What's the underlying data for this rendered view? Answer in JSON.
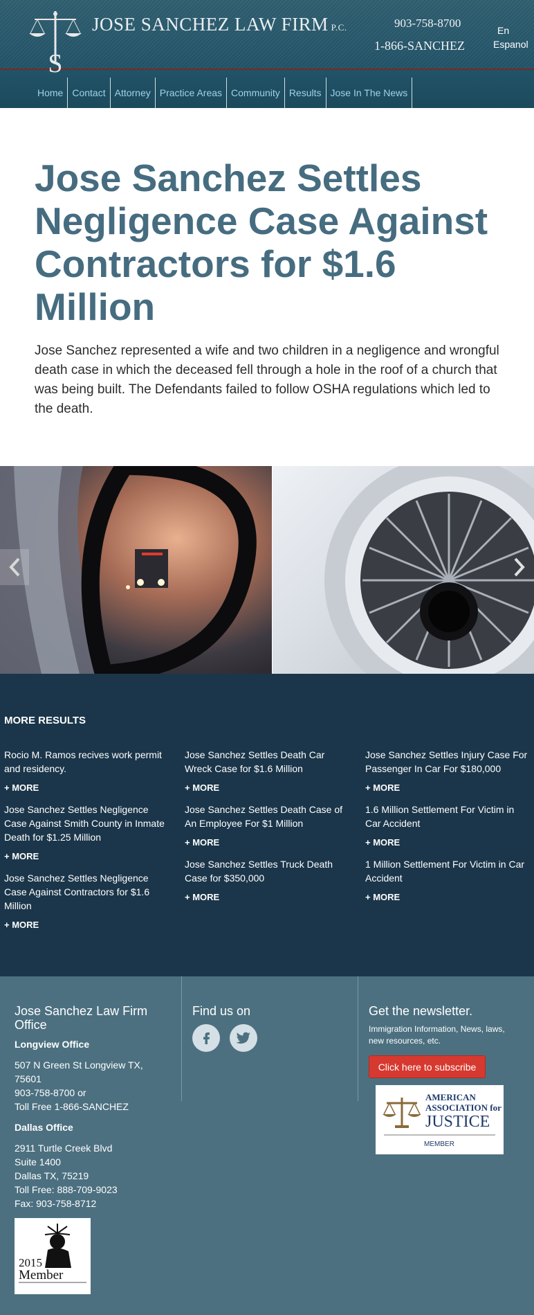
{
  "header": {
    "firm_name": "JOSE SANCHEZ LAW FIRM",
    "firm_suffix": "P.C.",
    "phone_local": "903-758-8700",
    "phone_tollfree": "1-866-SANCHEZ",
    "lang_en": "En",
    "lang_es": "Espanol"
  },
  "nav": {
    "items": [
      "Home",
      "Contact",
      "Attorney",
      "Practice Areas",
      "Community",
      "Results",
      "Jose In The News"
    ]
  },
  "article": {
    "title": "Jose Sanchez Settles Negligence Case Against Contractors for $1.6 Million",
    "body": "Jose Sanchez represented a wife and two children in a negligence and wrongful death case in which the deceased fell through a hole in the roof of a church that was being built. The Defendants failed to follow OSHA regulations which led to the death."
  },
  "results": {
    "heading": "MORE RESULTS",
    "more_label": "+ MORE",
    "col1": [
      "Rocio M. Ramos recives work permit and residency.",
      "Jose Sanchez Settles Negligence Case Against Smith County in Inmate Death for $1.25 Million",
      "Jose Sanchez Settles Negligence Case Against Contractors for $1.6 Million"
    ],
    "col2": [
      "Jose Sanchez Settles Death Car Wreck Case for $1.6 Million",
      "Jose Sanchez Settles Death Case of An Employee For $1 Million",
      "Jose Sanchez Settles Truck Death Case for $350,000"
    ],
    "col3": [
      "Jose Sanchez Settles Injury Case For Passenger In Car For $180,000",
      "1.6 Million Settlement For Victim in Car Accident",
      "1 Million Settlement For Victim in Car Accident"
    ]
  },
  "footer": {
    "office_title": "Jose Sanchez Law Firm Office",
    "longview_label": "Longview Office",
    "longview_lines": [
      "507 N Green St Longview TX,",
      "75601",
      "903-758-8700 or",
      "Toll Free 1-866-SANCHEZ"
    ],
    "dallas_label": "Dallas Office",
    "dallas_lines": [
      "2911 Turtle Creek Blvd",
      "Suite 1400",
      "Dallas TX, 75219",
      "Toll Free: 888-709-9023",
      "Fax: 903-758-8712"
    ],
    "findus": "Find us on",
    "newsletter_title": "Get the newsletter.",
    "newsletter_text": "Immigration Information, News, laws, new resources, etc.",
    "subscribe_label": "Click here to subscribe",
    "aaj_line1": "AMERICAN",
    "aaj_line2": "ASSOCIATION for",
    "aaj_line3": "JUSTICE",
    "aaj_member": "MEMBER",
    "badge_year": "2015",
    "badge_member": "Member"
  },
  "colors": {
    "header_bg": "#24556a",
    "nav_link": "#9fd2e8",
    "title": "#466c80",
    "results_bg": "#1b364a",
    "footer_bg": "#4c7080",
    "subscribe": "#d6392f"
  },
  "icons": [
    "scales-logo-icon",
    "chevron-left-icon",
    "chevron-right-icon",
    "facebook-icon",
    "twitter-icon",
    "scales-icon",
    "statue-of-liberty-icon"
  ]
}
